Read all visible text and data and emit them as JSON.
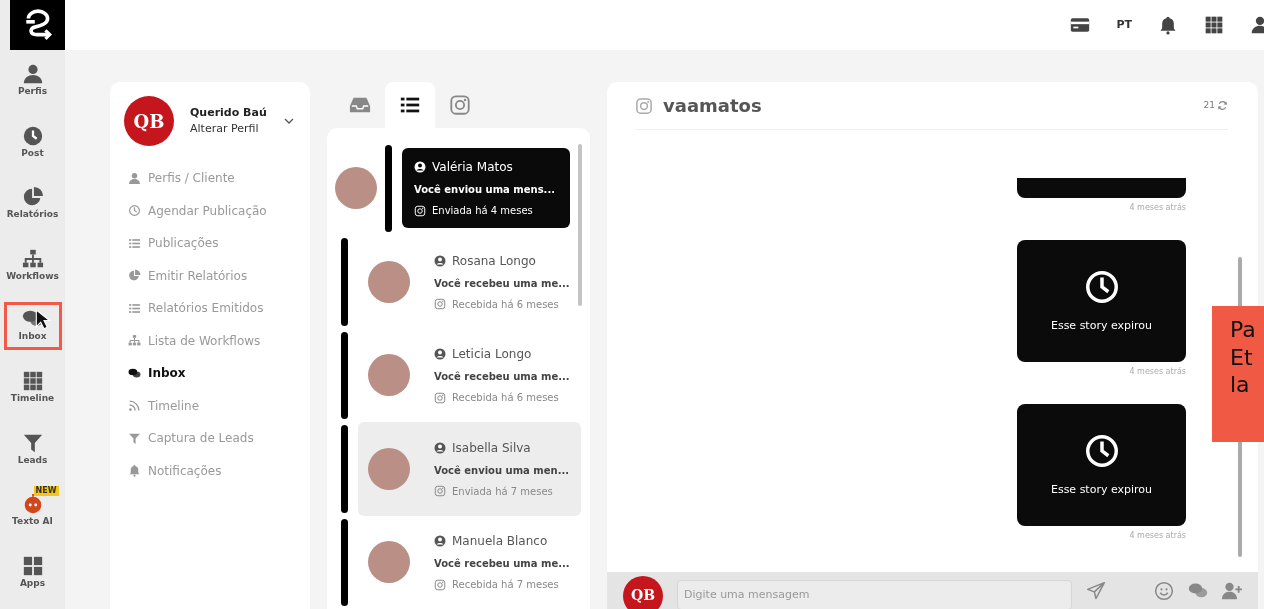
{
  "topbar": {
    "language": "PT"
  },
  "rail": {
    "items": [
      {
        "label": "Perfis",
        "selected": false
      },
      {
        "label": "Post",
        "selected": false
      },
      {
        "label": "Relatórios",
        "selected": false
      },
      {
        "label": "Workflows",
        "selected": false
      },
      {
        "label": "Inbox",
        "selected": true
      },
      {
        "label": "Timeline",
        "selected": false
      },
      {
        "label": "Leads",
        "selected": false
      },
      {
        "label": "Texto AI",
        "selected": false,
        "badge": "NEW"
      },
      {
        "label": "Apps",
        "selected": false
      }
    ]
  },
  "profile": {
    "initials": "QB",
    "name": "Querido Baú",
    "subtitle": "Alterar Perfil",
    "menu": [
      {
        "label": "Perfis / Cliente",
        "selected": false
      },
      {
        "label": "Agendar Publicação",
        "selected": false
      },
      {
        "label": "Publicações",
        "selected": false
      },
      {
        "label": "Emitir Relatórios",
        "selected": false
      },
      {
        "label": "Relatórios Emitidos",
        "selected": false
      },
      {
        "label": "Lista de Workflows",
        "selected": false
      },
      {
        "label": "Inbox",
        "selected": true
      },
      {
        "label": "Timeline",
        "selected": false
      },
      {
        "label": "Captura de Leads",
        "selected": false
      },
      {
        "label": "Notificações",
        "selected": false
      }
    ]
  },
  "list_tabs": [
    {
      "selected": false
    },
    {
      "selected": true
    },
    {
      "selected": false
    }
  ],
  "conversations": [
    {
      "name": "Valéria Matos",
      "preview": "Você enviou uma mens...",
      "status": "Enviada há 4 meses",
      "selected": true,
      "highlighted": false
    },
    {
      "name": "Rosana Longo",
      "preview": "Você recebeu uma me...",
      "status": "Recebida há 6 meses",
      "selected": false,
      "highlighted": false
    },
    {
      "name": "Leticia Longo",
      "preview": "Você recebeu uma me...",
      "status": "Recebida há 6 meses",
      "selected": false,
      "highlighted": false
    },
    {
      "name": "Isabella Silva",
      "preview": "Você enviou uma men...",
      "status": "Enviada há 7 meses",
      "selected": false,
      "highlighted": true
    },
    {
      "name": "Manuela Blanco",
      "preview": "Você recebeu uma me...",
      "status": "Recebida há 7 meses",
      "selected": false,
      "highlighted": false
    }
  ],
  "chat": {
    "username": "vaamatos",
    "count": "21",
    "messages": [
      {
        "kind": "cut",
        "time": "4 meses atrás"
      },
      {
        "kind": "story",
        "text": "Esse story expirou",
        "time": "4 meses atrás"
      },
      {
        "kind": "story",
        "text": "Esse story expirou",
        "time": "4 meses atrás"
      }
    ],
    "composer": {
      "initials": "QB",
      "placeholder": "Digite uma mensagem"
    }
  },
  "overlay_note": {
    "text": "Pa\nEt\nla"
  }
}
